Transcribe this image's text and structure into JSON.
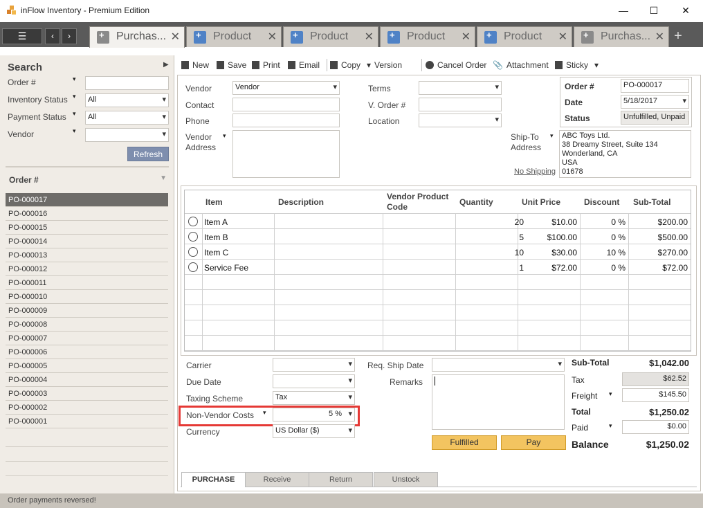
{
  "window": {
    "title": "inFlow Inventory - Premium Edition",
    "minimize": "—",
    "maximize": "☐",
    "close": "✕"
  },
  "tabs": [
    {
      "label": "Purchas...",
      "type": "po",
      "active": true
    },
    {
      "label": "Product",
      "type": "product",
      "active": false
    },
    {
      "label": "Product",
      "type": "product",
      "active": false
    },
    {
      "label": "Product",
      "type": "product",
      "active": false
    },
    {
      "label": "Product",
      "type": "product",
      "active": false
    },
    {
      "label": "Purchas...",
      "type": "po",
      "active": false
    }
  ],
  "tab_close": "✕",
  "tab_add": "+",
  "left": {
    "title": "Search",
    "expand": "▶",
    "filters": [
      {
        "label": "Order #",
        "value": ""
      },
      {
        "label": "Inventory Status",
        "value": "All"
      },
      {
        "label": "Payment Status",
        "value": "All"
      },
      {
        "label": "Vendor",
        "value": ""
      }
    ],
    "refresh": "Refresh",
    "list_header": "Order #",
    "orders": [
      "PO-000017",
      "PO-000016",
      "PO-000015",
      "PO-000014",
      "PO-000013",
      "PO-000012",
      "PO-000011",
      "PO-000010",
      "PO-000009",
      "PO-000008",
      "PO-000007",
      "PO-000006",
      "PO-000005",
      "PO-000004",
      "PO-000003",
      "PO-000002",
      "PO-000001"
    ],
    "selected_order": "PO-000017"
  },
  "toolbar": {
    "new": "New",
    "save": "Save",
    "print": "Print",
    "email": "Email",
    "copy": "Copy",
    "version": "Version",
    "cancel": "Cancel Order",
    "attachment": "Attachment",
    "sticky": "Sticky"
  },
  "header": {
    "vendor_label": "Vendor",
    "vendor_value": "Vendor",
    "contact_label": "Contact",
    "contact_value": "",
    "phone_label": "Phone",
    "phone_value": "",
    "vendor_address_label1": "Vendor",
    "vendor_address_label2": "Address",
    "vendor_address_value": "",
    "terms_label": "Terms",
    "terms_value": "",
    "vorder_label": "V. Order #",
    "vorder_value": "",
    "location_label": "Location",
    "location_value": "",
    "order_label": "Order #",
    "order_value": "PO-000017",
    "date_label": "Date",
    "date_value": "5/18/2017",
    "status_label": "Status",
    "status_value": "Unfulfilled, Unpaid",
    "shipto_label1": "Ship-To",
    "shipto_label2": "Address",
    "no_shipping": "No Shipping",
    "shipto_lines": [
      "ABC Toys Ltd.",
      "38 Dreamy Street, Suite 134",
      "Wonderland, CA",
      "USA",
      "01678"
    ]
  },
  "grid": {
    "columns": [
      "Item",
      "Description",
      "Vendor Product",
      "Code",
      "Quantity",
      "Unit Price",
      "Discount",
      "Sub-Total"
    ],
    "rows": [
      {
        "item": "Item A",
        "description": "",
        "code": "",
        "qty": "20",
        "price": "$10.00",
        "discount": "0 %",
        "subtotal": "$200.00"
      },
      {
        "item": "Item B",
        "description": "",
        "code": "",
        "qty": "5",
        "price": "$100.00",
        "discount": "0 %",
        "subtotal": "$500.00"
      },
      {
        "item": "Item C",
        "description": "",
        "code": "",
        "qty": "10",
        "price": "$30.00",
        "discount": "10 %",
        "subtotal": "$270.00"
      },
      {
        "item": "Service Fee",
        "description": "",
        "code": "",
        "qty": "1",
        "price": "$72.00",
        "discount": "0 %",
        "subtotal": "$72.00"
      }
    ]
  },
  "footer": {
    "carrier_label": "Carrier",
    "carrier_value": "",
    "due_label": "Due Date",
    "due_value": "",
    "taxing_label": "Taxing Scheme",
    "taxing_value": "Tax",
    "nonvendor_label": "Non-Vendor Costs",
    "nonvendor_value": "5 %",
    "currency_label": "Currency",
    "currency_value": "US Dollar ($)",
    "reqship_label": "Req. Ship Date",
    "reqship_value": "",
    "remarks_label": "Remarks",
    "remarks_value": "",
    "fulfilled_btn": "Fulfilled",
    "pay_btn": "Pay",
    "subtotal_label": "Sub-Total",
    "subtotal_value": "$1,042.00",
    "tax_label": "Tax",
    "tax_value": "$62.52",
    "freight_label": "Freight",
    "freight_value": "$145.50",
    "total_label": "Total",
    "total_value": "$1,250.02",
    "paid_label": "Paid",
    "paid_value": "$0.00",
    "balance_label": "Balance",
    "balance_value": "$1,250.02"
  },
  "bottom_tabs": [
    "PURCHASE",
    "Receive",
    "Return",
    "Unstock"
  ],
  "status_text": "Order payments reversed!",
  "colors": {
    "accent": "#f3c460",
    "highlight": "#e53935",
    "selected": "#6e6c69"
  }
}
